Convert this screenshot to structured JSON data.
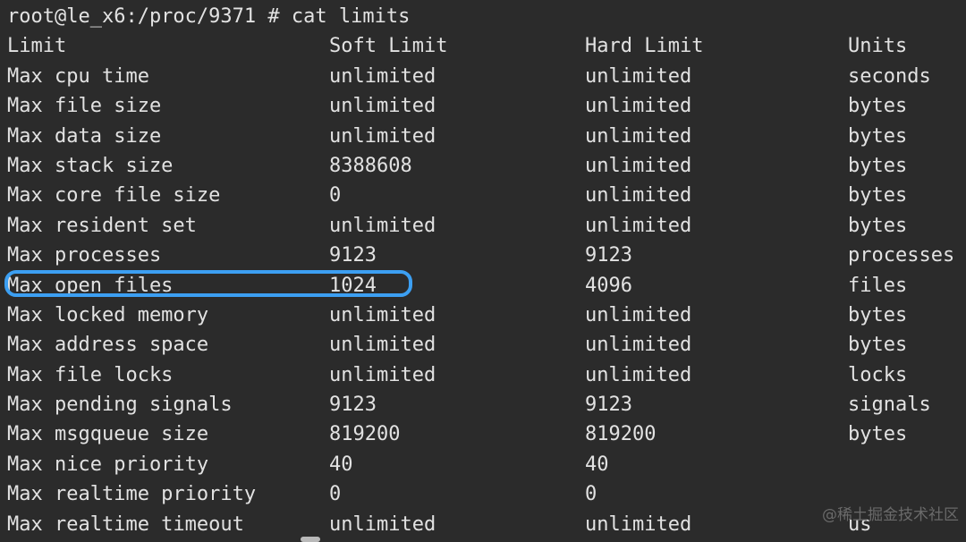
{
  "terminal": {
    "background_color": "#2b2b2b",
    "foreground_color": "#e2e2e2",
    "prompt_line": "root@le_x6:/proc/9371 # cat limits",
    "columns": {
      "limit": "Limit",
      "soft": "Soft Limit",
      "hard": "Hard Limit",
      "units": "Units"
    },
    "rows": [
      {
        "limit": "Max cpu time",
        "soft": "unlimited",
        "hard": "unlimited",
        "units": "seconds"
      },
      {
        "limit": "Max file size",
        "soft": "unlimited",
        "hard": "unlimited",
        "units": "bytes"
      },
      {
        "limit": "Max data size",
        "soft": "unlimited",
        "hard": "unlimited",
        "units": "bytes"
      },
      {
        "limit": "Max stack size",
        "soft": "8388608",
        "hard": "unlimited",
        "units": "bytes"
      },
      {
        "limit": "Max core file size",
        "soft": "0",
        "hard": "unlimited",
        "units": "bytes"
      },
      {
        "limit": "Max resident set",
        "soft": "unlimited",
        "hard": "unlimited",
        "units": "bytes"
      },
      {
        "limit": "Max processes",
        "soft": "9123",
        "hard": "9123",
        "units": "processes"
      },
      {
        "limit": "Max open files",
        "soft": "1024",
        "hard": "4096",
        "units": "files"
      },
      {
        "limit": "Max locked memory",
        "soft": "unlimited",
        "hard": "unlimited",
        "units": "bytes"
      },
      {
        "limit": "Max address space",
        "soft": "unlimited",
        "hard": "unlimited",
        "units": "bytes"
      },
      {
        "limit": "Max file locks",
        "soft": "unlimited",
        "hard": "unlimited",
        "units": "locks"
      },
      {
        "limit": "Max pending signals",
        "soft": "9123",
        "hard": "9123",
        "units": "signals"
      },
      {
        "limit": "Max msgqueue size",
        "soft": "819200",
        "hard": "819200",
        "units": "bytes"
      },
      {
        "limit": "Max nice priority",
        "soft": "40",
        "hard": "40",
        "units": ""
      },
      {
        "limit": "Max realtime priority",
        "soft": "0",
        "hard": "0",
        "units": ""
      },
      {
        "limit": "Max realtime timeout",
        "soft": "unlimited",
        "hard": "unlimited",
        "units": "us"
      }
    ]
  },
  "annotation": {
    "highlight_color": "#3c9ff2",
    "highlighted_row_label": "Max open files",
    "highlighted_row_value": "1024"
  },
  "watermark": {
    "text": "@稀土掘金技术社区"
  }
}
